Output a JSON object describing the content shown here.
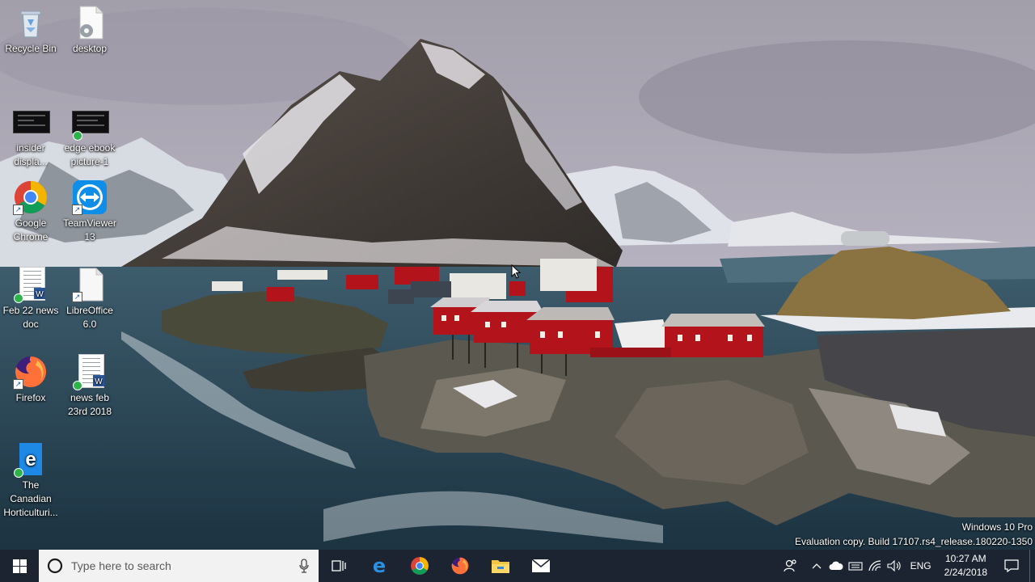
{
  "desktop": {
    "icons": [
      {
        "label": "Recycle Bin"
      },
      {
        "label": "desktop"
      },
      {
        "label": "insider displa..."
      },
      {
        "label": "edge ebook picture-1"
      },
      {
        "label": "Google Chrome"
      },
      {
        "label": "TeamViewer 13"
      },
      {
        "label": "Feb 22 news doc"
      },
      {
        "label": "LibreOffice 6.0"
      },
      {
        "label": "Firefox"
      },
      {
        "label": "news feb 23rd 2018"
      },
      {
        "label": "The Canadian Horticulturi..."
      }
    ]
  },
  "watermark": {
    "line1": "Windows 10 Pro",
    "line2": "Evaluation copy. Build 17107.rs4_release.180220-1350"
  },
  "taskbar": {
    "search_placeholder": "Type here to search",
    "pinned": [
      {
        "icon": "task-view-icon"
      },
      {
        "icon": "edge-icon"
      },
      {
        "icon": "chrome-icon"
      },
      {
        "icon": "firefox-icon"
      },
      {
        "icon": "file-explorer-icon"
      },
      {
        "icon": "mail-icon"
      }
    ],
    "tray": {
      "language": "ENG",
      "time": "10:27 AM",
      "date": "2/24/2018"
    }
  },
  "colors": {
    "taskbar": "#1b2430",
    "search_box": "#f2f2f2",
    "house_red": "#b3141c"
  }
}
